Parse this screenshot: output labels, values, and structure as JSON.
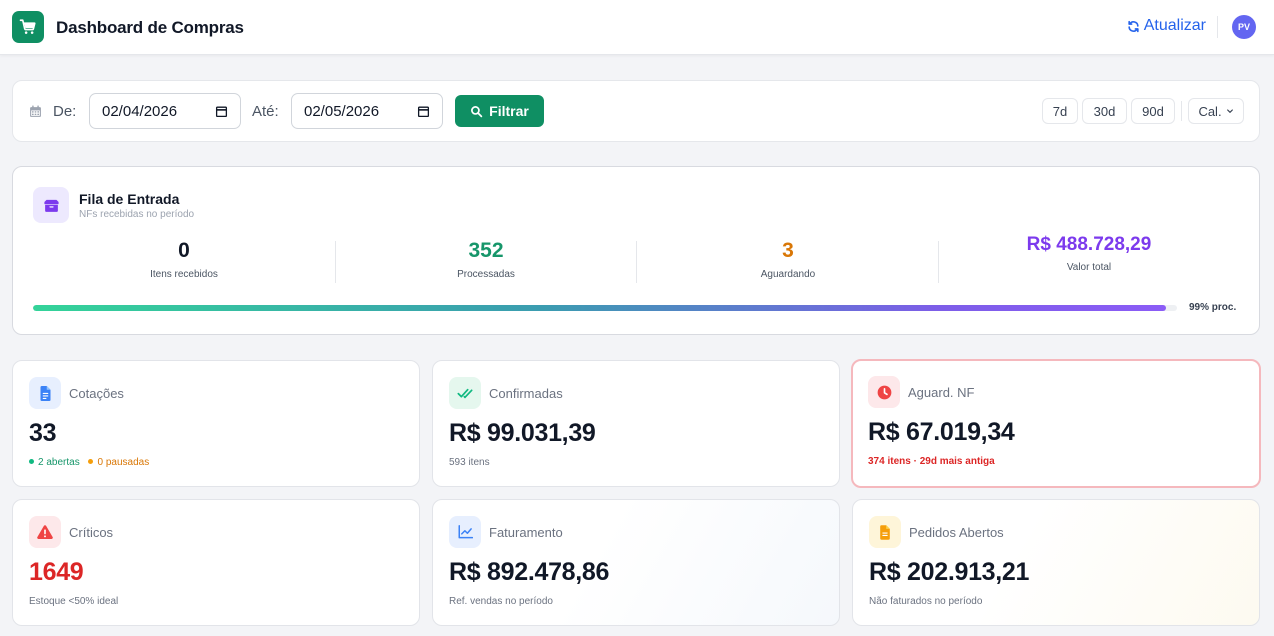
{
  "header": {
    "title": "Dashboard de Compras",
    "refresh_label": "Atualizar",
    "avatar_initials": "PV",
    "logo_icon": "shopping-cart-icon"
  },
  "filters": {
    "from_label": "De:",
    "from_value": "02/04/2026",
    "to_label": "Até:",
    "to_value": "02/05/2026",
    "filter_button": "Filtrar",
    "range_7d": "7d",
    "range_30d": "30d",
    "range_90d": "90d",
    "calendar_dropdown": "Cal."
  },
  "queue": {
    "title": "Fila de Entrada",
    "subtitle": "NFs recebidas no período",
    "received_value": "0",
    "received_label": "Itens recebidos",
    "processed_value": "352",
    "processed_label": "Processadas",
    "waiting_value": "3",
    "waiting_label": "Aguardando",
    "total_value": "R$ 488.728,29",
    "total_label": "Valor total",
    "progress_percent": 99,
    "progress_label": "99% proc."
  },
  "cards": {
    "quotes": {
      "title": "Cotações",
      "value": "33",
      "open_text": "2 abertas",
      "paused_text": "0 pausadas"
    },
    "confirmed": {
      "title": "Confirmadas",
      "value": "R$ 99.031,39",
      "sub": "593 itens"
    },
    "awaiting_nf": {
      "title": "Aguard. NF",
      "value": "R$ 67.019,34",
      "sub": "374 itens · 29d mais antiga"
    },
    "critical": {
      "title": "Críticos",
      "value": "1649",
      "sub": "Estoque <50% ideal"
    },
    "billing": {
      "title": "Faturamento",
      "value": "R$ 892.478,86",
      "sub": "Ref. vendas no período"
    },
    "open_orders": {
      "title": "Pedidos Abertos",
      "value": "R$ 202.913,21",
      "sub": "Não faturados no período"
    }
  },
  "colors": {
    "brand_green": "#0f8f63",
    "link_blue": "#2563eb",
    "processed_green": "#16966a",
    "waiting_orange": "#d97706",
    "total_purple": "#7c3aed",
    "critical_red": "#dc2626"
  }
}
